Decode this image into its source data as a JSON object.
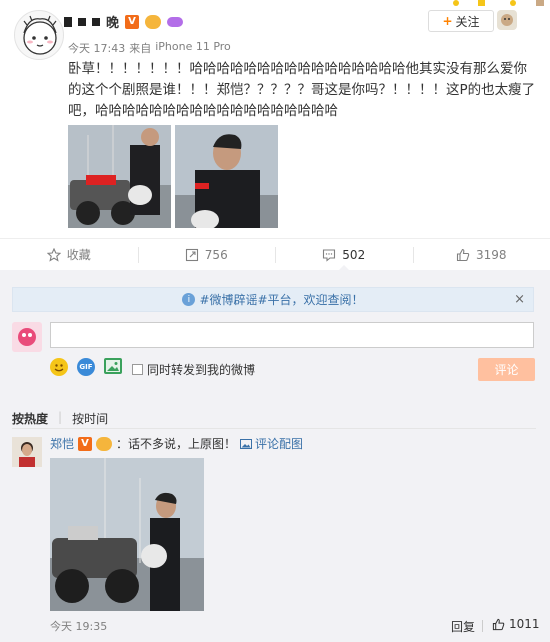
{
  "post": {
    "username_redacted": "███ 晚",
    "meta_time": "今天 17:43",
    "meta_from": "来自",
    "meta_device": "iPhone 11 Pro",
    "follow_label": "关注",
    "follow_plus": "+",
    "content": "卧草！！！！！！！哈哈哈哈哈哈哈哈哈哈哈哈哈哈哈哈他其实没有那么爱你的这个个剧照是谁！！！郑恺？？？？？哥这是你吗？！！！！这P的也太瘦了吧，哈哈哈哈哈哈哈哈哈哈哈哈哈哈哈哈哈哈"
  },
  "actions": {
    "favorite": "收藏",
    "repost": "756",
    "comment": "502",
    "like": "3198"
  },
  "notice": {
    "text": "#微博辟谣#平台，欢迎查阅！",
    "close": "×"
  },
  "composer": {
    "placeholder": "",
    "repost_label": "同时转发到我的微博",
    "submit_label": "评论",
    "gif_label": "GIF"
  },
  "sort": {
    "hot": "按热度",
    "time": "按时间"
  },
  "comment": {
    "name": "郑恺",
    "text": "：话不多说，上原图！",
    "link": "评论配图",
    "time": "今天 19:35",
    "reply": "回复",
    "likes": "1011"
  },
  "colors": {
    "orange": "#ff8200",
    "link": "#3a71a8",
    "submit": "#ffc09f"
  }
}
